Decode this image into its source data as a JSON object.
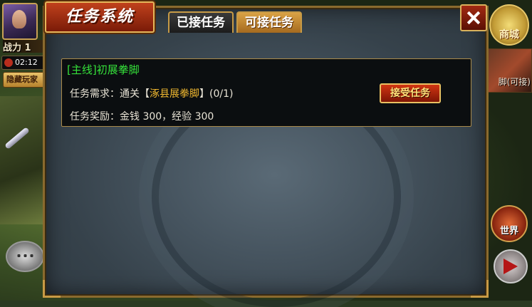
{
  "hud": {
    "power_label": "战力 1",
    "timer": "02:12",
    "hidden_play": "隐藏玩家",
    "shop_label": "商城",
    "task_tip": "脚(可接)",
    "world_label": "世界"
  },
  "dialog": {
    "title": "任务系统",
    "tabs": {
      "accepted": "已接任务",
      "available": "可接任务"
    }
  },
  "quest": {
    "title": "[主线]初展拳脚",
    "requirement_prefix": "任务需求：通关【",
    "requirement_place": "涿县展拳脚",
    "requirement_suffix": "】(0/1)",
    "reward": "任务奖励：金钱 300，经验 300",
    "accept_label": "接受任务"
  },
  "colors": {
    "quest_title": "#35e03a",
    "place_highlight": "#f0b830",
    "frame_gold": "#c89a45",
    "accent_red": "#c0411c"
  }
}
